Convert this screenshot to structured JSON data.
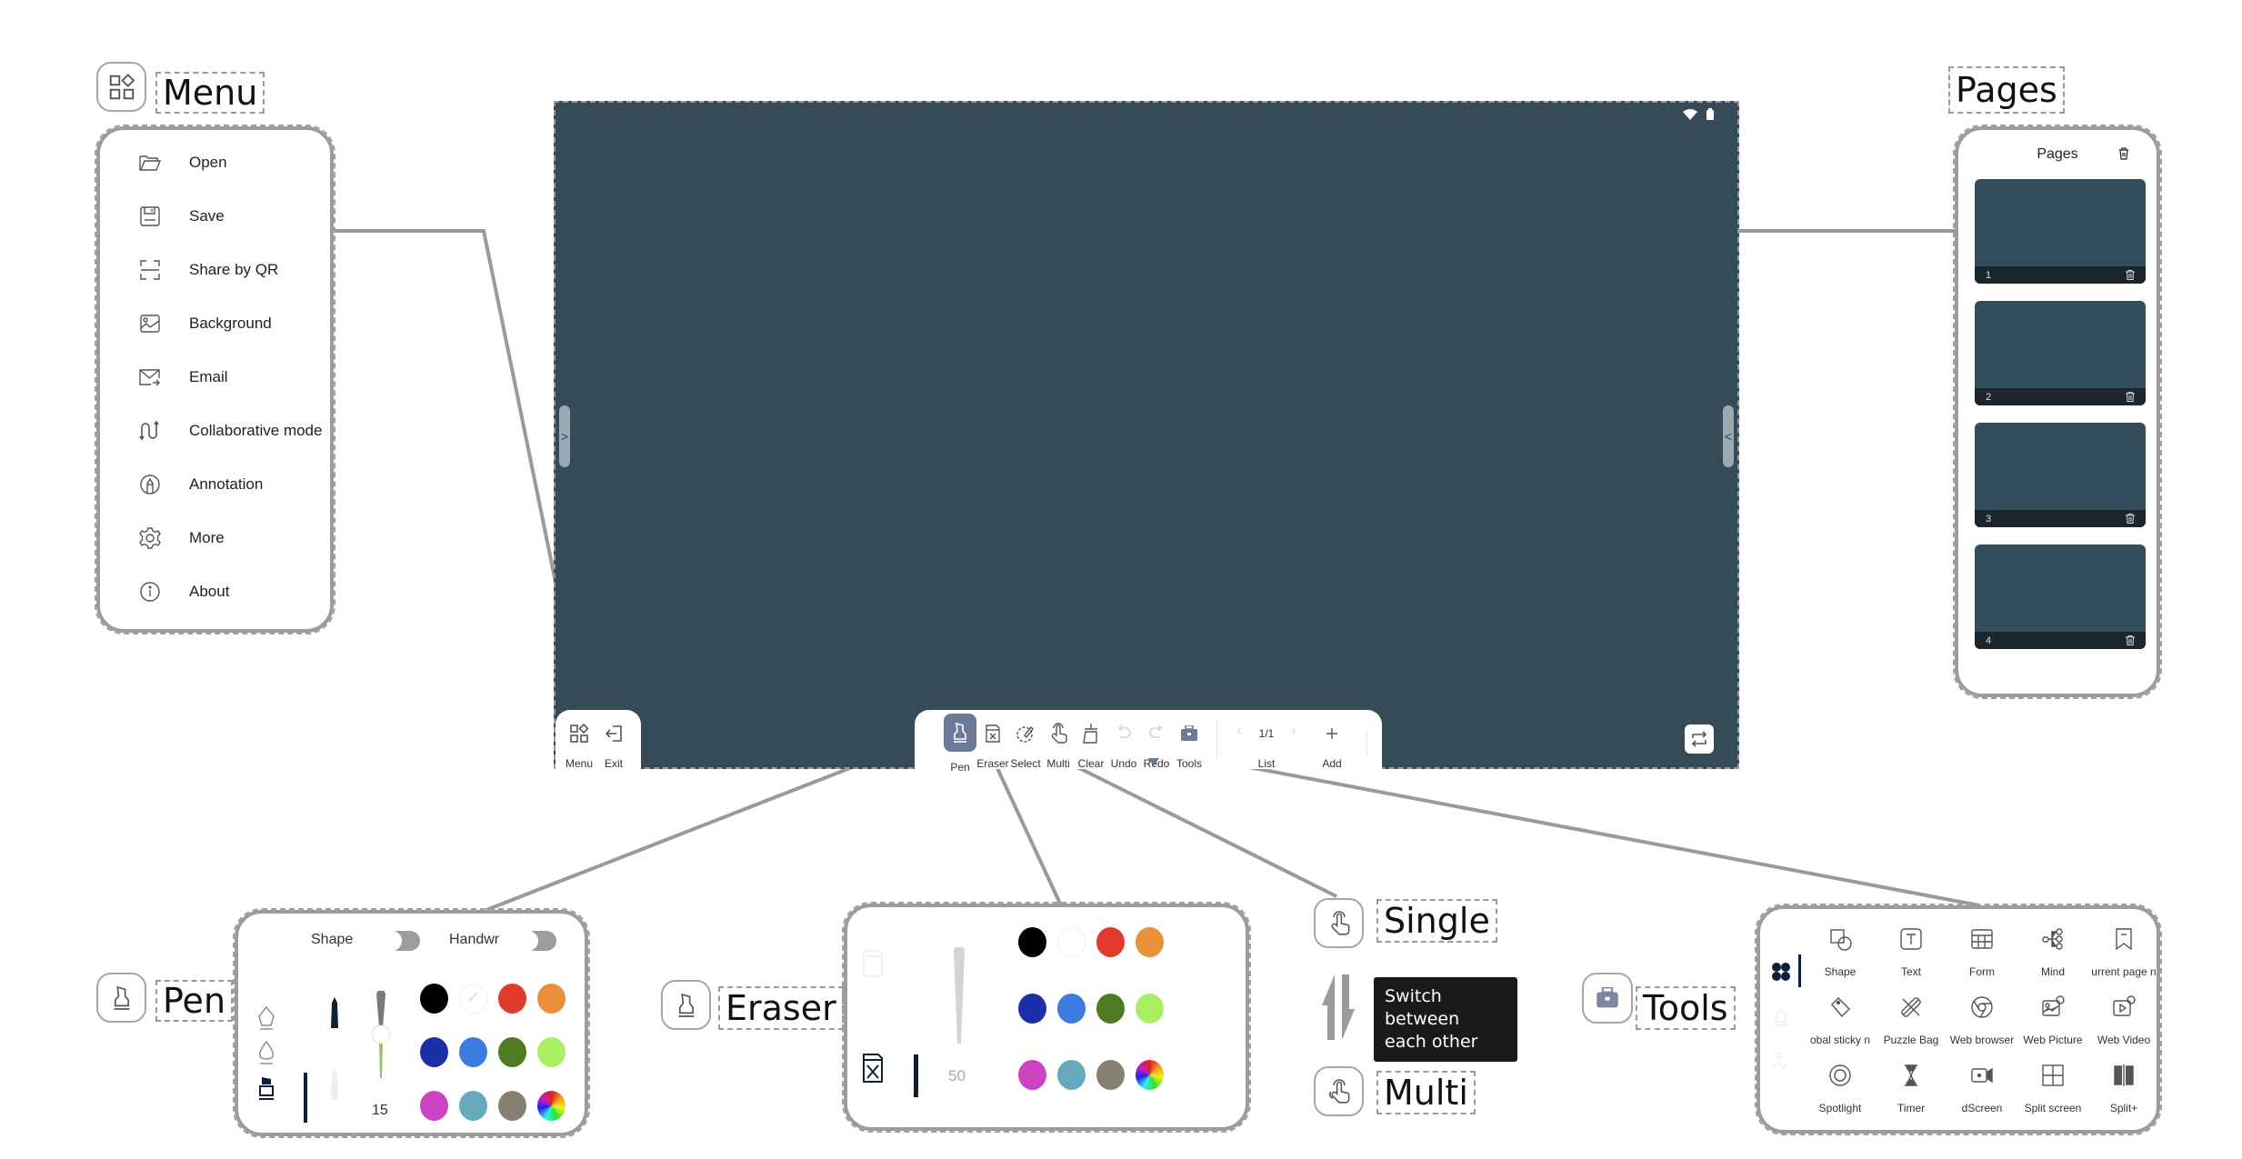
{
  "canvas": {
    "background_color": "#354b58",
    "status_icons": [
      "wifi-icon",
      "battery-icon"
    ],
    "left_handle_glyph": ">",
    "right_handle_glyph": "<"
  },
  "callouts": {
    "menu": "Menu",
    "pages": "Pages",
    "pen": "Pen",
    "eraser": "Eraser",
    "single": "Single",
    "multi": "Multi",
    "tools": "Tools",
    "switch_tooltip_line1": "Switch between",
    "switch_tooltip_line2": "each other"
  },
  "menu_panel": {
    "items": [
      {
        "label": "Open",
        "icon": "folder-open-icon"
      },
      {
        "label": "Save",
        "icon": "save-icon"
      },
      {
        "label": "Share by QR",
        "icon": "qr-scan-icon"
      },
      {
        "label": "Background",
        "icon": "image-icon"
      },
      {
        "label": "Email",
        "icon": "email-icon"
      },
      {
        "label": "Collaborative mode",
        "icon": "collaborate-icon"
      },
      {
        "label": "Annotation",
        "icon": "annotation-icon"
      },
      {
        "label": "More",
        "icon": "gear-icon"
      },
      {
        "label": "About",
        "icon": "info-icon"
      }
    ]
  },
  "pages_panel": {
    "title": "Pages",
    "pages": [
      {
        "number": "1"
      },
      {
        "number": "2"
      },
      {
        "number": "3"
      },
      {
        "number": "4"
      }
    ]
  },
  "left_toolbar": {
    "items": [
      {
        "label": "Menu",
        "icon": "menu-grid-icon"
      },
      {
        "label": "Exit",
        "icon": "exit-icon"
      }
    ]
  },
  "main_toolbar": {
    "items": [
      {
        "label": "Pen",
        "icon": "pen-icon",
        "active": true
      },
      {
        "label": "Eraser",
        "icon": "eraser-icon"
      },
      {
        "label": "Select",
        "icon": "select-icon"
      },
      {
        "label": "Multi",
        "icon": "touch-icon"
      },
      {
        "label": "Clear",
        "icon": "clear-icon"
      },
      {
        "label": "Undo",
        "icon": "undo-icon",
        "disabled": true
      },
      {
        "label": "Redo",
        "icon": "redo-icon",
        "disabled": true
      },
      {
        "label": "Tools",
        "icon": "toolbox-icon"
      }
    ],
    "page_indicator": "1/1",
    "list_label": "List",
    "add_label": "Add",
    "accent_color": "#6b7a98"
  },
  "pen_panel": {
    "shape_label": "Shape",
    "handwriting_label": "Handwr",
    "size_value": "15",
    "colors": [
      "#000000",
      "#ffffff",
      "#e03a2e",
      "#e8903a",
      "#1a2fa8",
      "#3c7be0",
      "#4e7a22",
      "#a8f060",
      "#cc44c4",
      "#68a8bc",
      "#868070",
      "rainbow"
    ],
    "selected_color": "#ffffff"
  },
  "eraser_panel": {
    "size_value": "50",
    "colors": [
      "#000000",
      "#ffffff",
      "#e03a2e",
      "#e8903a",
      "#1a2fa8",
      "#3c7be0",
      "#4e7a22",
      "#a8f060",
      "#cc44c4",
      "#68a8bc",
      "#868070",
      "rainbow"
    ]
  },
  "tools_panel": {
    "tools": [
      {
        "label": "Shape",
        "icon": "shape-icon"
      },
      {
        "label": "Text",
        "icon": "text-icon"
      },
      {
        "label": "Form",
        "icon": "table-icon"
      },
      {
        "label": "Mind",
        "icon": "mindmap-icon"
      },
      {
        "label": "urrent page n",
        "icon": "bookmark-icon"
      },
      {
        "label": "obal sticky n",
        "icon": "tag-icon"
      },
      {
        "label": "Puzzle Bag",
        "icon": "puzzle-tools-icon"
      },
      {
        "label": "Web browser",
        "icon": "browser-icon"
      },
      {
        "label": "Web Picture",
        "icon": "web-picture-icon"
      },
      {
        "label": "Web Video",
        "icon": "web-video-icon"
      },
      {
        "label": "Spotlight",
        "icon": "spotlight-icon"
      },
      {
        "label": "Timer",
        "icon": "hourglass-icon"
      },
      {
        "label": "dScreen",
        "icon": "record-icon"
      },
      {
        "label": "Split screen",
        "icon": "split-screen-icon"
      },
      {
        "label": "Split+",
        "icon": "split-plus-icon"
      }
    ]
  }
}
